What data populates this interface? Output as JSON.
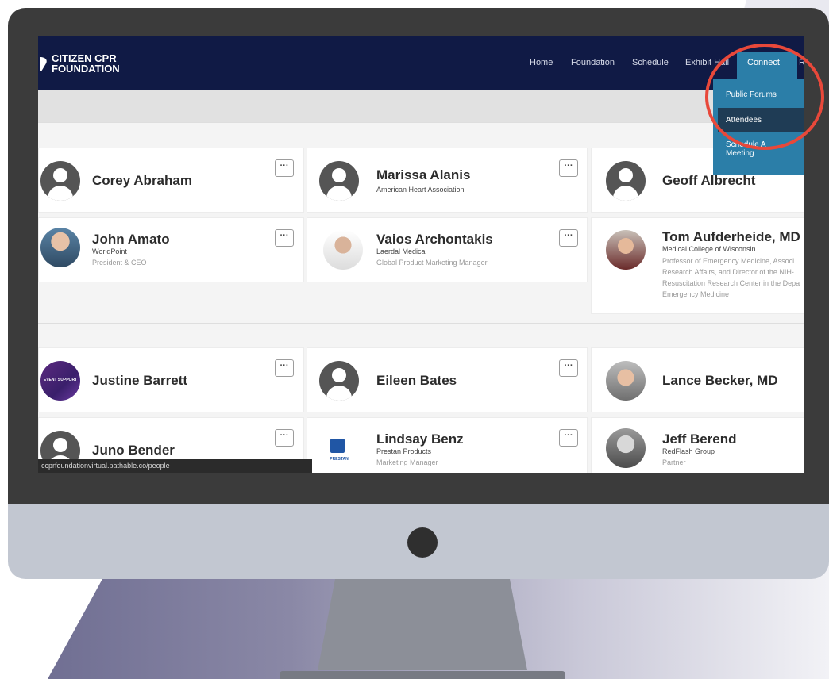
{
  "brand": {
    "line1": "CITIZEN CPR",
    "line2": "FOUNDATION"
  },
  "nav": {
    "home": "Home",
    "foundation": "Foundation",
    "schedule": "Schedule",
    "exhibit_hall": "Exhibit Hall",
    "connect": "Connect",
    "overflow": "R"
  },
  "dropdown": {
    "public_forums": "Public Forums",
    "attendees": "Attendees",
    "schedule_line1": "Schedule A",
    "schedule_line2": "Meeting"
  },
  "more_label": "···",
  "people": [
    {
      "name": "Corey Abraham",
      "org": "",
      "role": ""
    },
    {
      "name": "Marissa Alanis",
      "org": "American Heart Association",
      "role": ""
    },
    {
      "name": "Geoff Albrecht",
      "org": "",
      "role": ""
    },
    {
      "name": "John Amato",
      "org": "WorldPoint",
      "role": "President & CEO"
    },
    {
      "name": "Vaios Archontakis",
      "org": "Laerdal Medical",
      "role": "Global Product Marketing Manager"
    },
    {
      "name": "Tom Aufderheide, MD",
      "org": "Medical College of Wisconsin",
      "role_lines": [
        "Professor of Emergency Medicine, Associ",
        "Research Affairs, and Director of the NIH-",
        "Resuscitation Research Center in the Depa",
        "Emergency Medicine"
      ]
    },
    {
      "name": "Justine Barrett",
      "org": "",
      "role": "",
      "avatar_text": "EVENT SUPPORT"
    },
    {
      "name": "Eileen Bates",
      "org": "",
      "role": ""
    },
    {
      "name": "Lance Becker, MD",
      "org": "",
      "role": ""
    },
    {
      "name": "Juno Bender",
      "org": "",
      "role": ""
    },
    {
      "name": "Lindsay Benz",
      "org": "Prestan Products",
      "role": "Marketing Manager",
      "avatar_text": "PRESTAN"
    },
    {
      "name": "Jeff Berend",
      "org": "RedFlash Group",
      "role": "Partner"
    }
  ],
  "status_url": "ccprfoundationvirtual.pathable.co/people",
  "colors": {
    "header": "#101a45",
    "accent": "#2b7ea8",
    "highlight_ring": "#e8483a"
  }
}
